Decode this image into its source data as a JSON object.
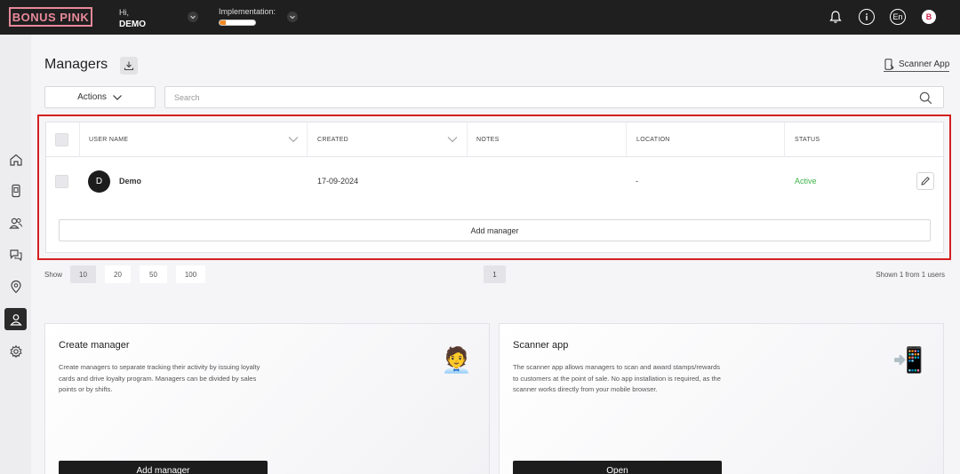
{
  "brand": {
    "logo": "BONUS PINK",
    "accent": "#e8899a"
  },
  "header": {
    "greeting": "Hi,",
    "user": "DEMO",
    "implementation_label": "Implementation:",
    "implementation_progress": 0.18,
    "language": "En",
    "avatar_letter": "B"
  },
  "sidebar": {
    "items": [
      {
        "icon": "home-icon"
      },
      {
        "icon": "phone-card-icon"
      },
      {
        "icon": "users-icon"
      },
      {
        "icon": "chat-icon"
      },
      {
        "icon": "location-icon"
      },
      {
        "icon": "manager-icon",
        "active": true
      },
      {
        "icon": "gear-icon"
      }
    ]
  },
  "page": {
    "title": "Managers",
    "scanner_link": "Scanner App",
    "actions_label": "Actions",
    "search_placeholder": "Search"
  },
  "table": {
    "columns": [
      "USER NAME",
      "CREATED",
      "NOTES",
      "LOCATION",
      "STATUS"
    ],
    "rows": [
      {
        "avatar": "D",
        "name": "Demo",
        "created": "17-09-2024",
        "notes": "",
        "location": "-",
        "status": "Active"
      }
    ],
    "status_color": "#3cb34a",
    "add_button": "Add manager"
  },
  "pagination": {
    "show_label": "Show",
    "sizes": [
      "10",
      "20",
      "50",
      "100"
    ],
    "current_page": "1",
    "summary": "Shown 1 from 1 users"
  },
  "cards": [
    {
      "title": "Create manager",
      "text": "Create managers to separate tracking their activity by issuing loyalty cards and drive loyalty program. Managers can be divided by sales points or by shifts.",
      "emoji": "🧑‍💼",
      "button": "Add manager"
    },
    {
      "title": "Scanner app",
      "text": "The scanner app allows managers to scan and award stamps/rewards to customers at the point of sale. No app installation is required, as the scanner works directly from your mobile browser.",
      "emoji": "📲",
      "button": "Open"
    }
  ]
}
